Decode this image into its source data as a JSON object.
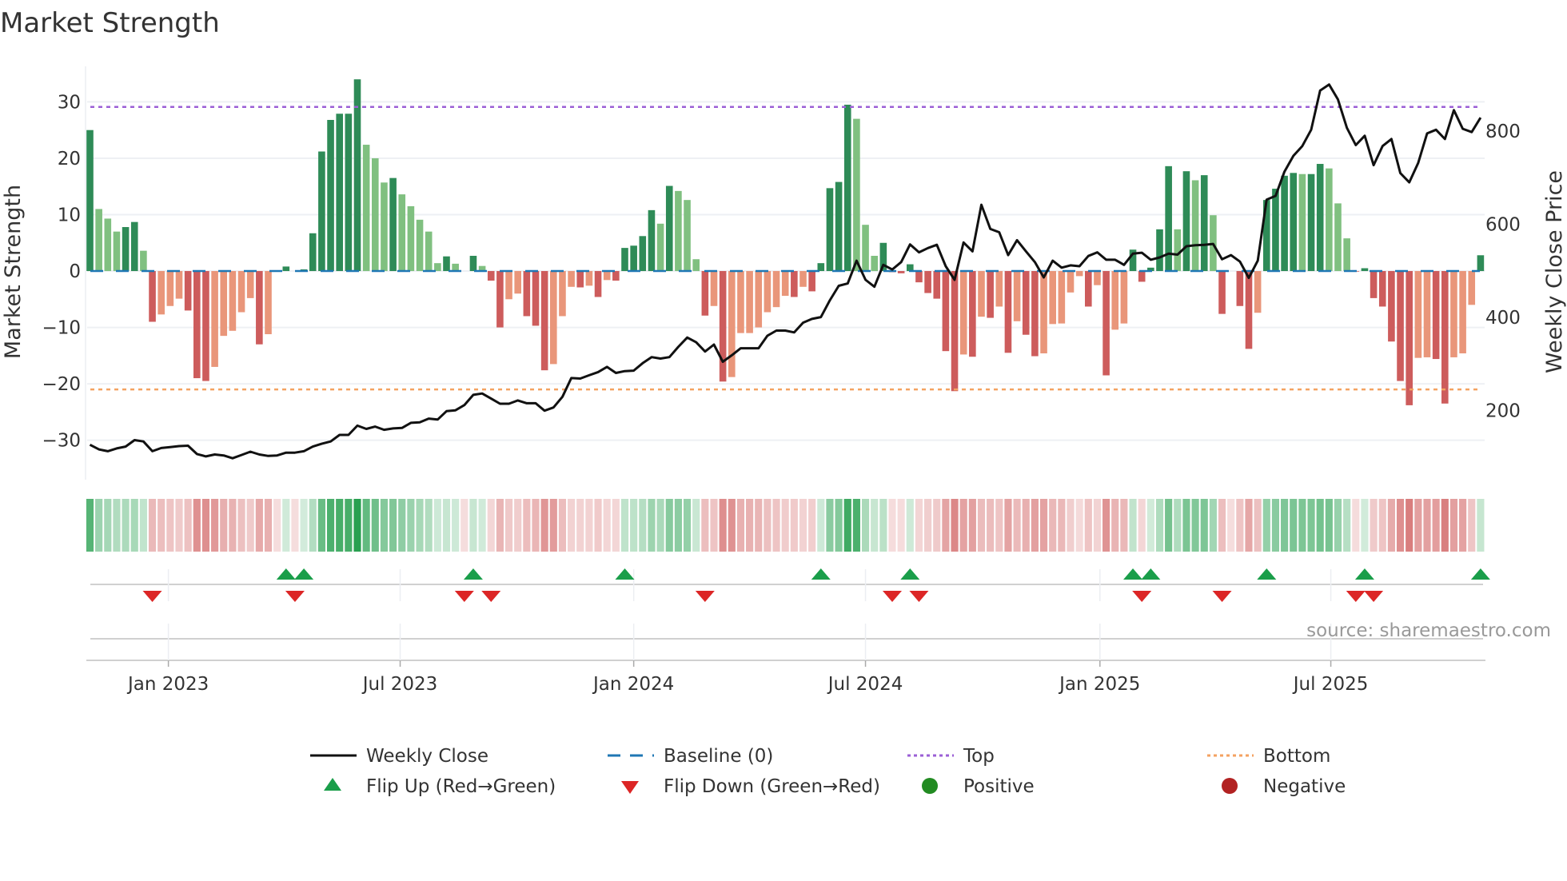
{
  "title": "Market Strength",
  "source": "source: sharemaestro.com",
  "colors": {
    "pos_rising": "#2e8b57",
    "pos_falling": "#80c080",
    "neg_falling": "#cd5c5c",
    "neg_rising": "#e9967a",
    "weekly_close": "#111111",
    "baseline": "#1f77b4",
    "top": "#9b5fd6",
    "bottom": "#f4a261",
    "flip_up": "#1a9e4a",
    "flip_down": "#dc2626",
    "positive": "#228b22",
    "negative": "#b22222"
  },
  "chart_data": {
    "type": "bar",
    "title": "Market Strength",
    "ylabel": "Market Strength",
    "y2label": "Weekly Close Price",
    "ylim": [
      -37,
      36.3
    ],
    "y2lim": [
      52,
      939
    ],
    "yticks": [
      -30,
      -20,
      -10,
      0,
      10,
      20,
      30
    ],
    "yticklabels": [
      "−30",
      "−20",
      "−10",
      "0",
      "10",
      "20",
      "30"
    ],
    "y2ticks": [
      200,
      400,
      600,
      800
    ],
    "y2ticklabels": [
      "200",
      "400",
      "600",
      "800"
    ],
    "xticks": [
      {
        "label": "Jan 2023",
        "week": 9.8
      },
      {
        "label": "Jul 2023",
        "week": 35.8
      },
      {
        "label": "Jan 2024",
        "week": 62.0
      },
      {
        "label": "Jul 2024",
        "week": 88.0
      },
      {
        "label": "Jan 2025",
        "week": 114.3
      },
      {
        "label": "Jul 2025",
        "week": 140.2
      }
    ],
    "top_level": 29.1,
    "bottom_level": -21.0,
    "baseline": 0,
    "strength": [
      25,
      11,
      9.3,
      7,
      7.8,
      8.7,
      3.6,
      -9,
      -7.7,
      -6.2,
      -4.9,
      -7,
      -19,
      -19.5,
      -17,
      -11.5,
      -10.6,
      -7.3,
      -4.8,
      -13,
      -11.2,
      0,
      0.8,
      0,
      0.3,
      6.7,
      21.2,
      26.8,
      27.9,
      27.9,
      34,
      22.4,
      20,
      15.7,
      16.5,
      13.6,
      11.5,
      9.1,
      7,
      1.4,
      2.6,
      1.3,
      0,
      2.7,
      0.9,
      -1.7,
      -10,
      -5,
      -4,
      -8,
      -9.7,
      -17.6,
      -16.5,
      -8,
      -2.8,
      -2.9,
      -2.6,
      -4.6,
      -1.6,
      -1.7,
      4.1,
      4.5,
      6.2,
      10.8,
      8.4,
      15.1,
      14.2,
      12.6,
      2.1,
      -7.9,
      -6.2,
      -19.6,
      -18.8,
      -11,
      -11,
      -10,
      -7.3,
      -6.4,
      -4.4,
      -4.6,
      -2.8,
      -3.6,
      1.4,
      14.7,
      15.8,
      29.5,
      27,
      8.2,
      2.7,
      5,
      -0.2,
      -0.4,
      1.2,
      -2,
      -3.9,
      -4.9,
      -14.2,
      -21.3,
      -14.8,
      -15.2,
      -8.1,
      -8.3,
      -6.3,
      -14.5,
      -8.9,
      -11.3,
      -15.1,
      -14.6,
      -9.4,
      -9.3,
      -3.8,
      -0.9,
      -6.3,
      -2.5,
      -18.5,
      -10.4,
      -9.3,
      3.8,
      -1.9,
      0.6,
      7.4,
      18.6,
      7.4,
      17.7,
      16.1,
      17,
      9.9,
      -7.6,
      0,
      -6.2,
      -13.8,
      -7.4,
      12.6,
      14.6,
      16.9,
      17.4,
      17.2,
      17.2,
      19,
      18.2,
      12,
      5.8,
      -0.1,
      0.5,
      -4.8,
      -6.3,
      -12.5,
      -19.5,
      -23.8,
      -15.4,
      -15.3,
      -15.6,
      -23.5,
      -15.3,
      -14.6,
      -6,
      2.8
    ],
    "weekly_close": [
      127,
      117,
      113,
      119,
      123,
      137,
      134,
      113,
      120,
      122,
      124,
      125,
      107,
      102,
      106,
      104,
      98,
      105,
      112,
      106,
      103,
      104,
      110,
      110,
      113,
      123,
      129,
      134,
      148,
      148,
      168,
      161,
      166,
      159,
      162,
      163,
      174,
      175,
      183,
      181,
      199,
      201,
      212,
      234,
      237,
      226,
      215,
      215,
      222,
      216,
      216,
      200,
      207,
      230,
      270,
      269,
      276,
      283,
      294,
      281,
      285,
      286,
      302,
      315,
      312,
      315,
      337,
      357,
      347,
      327,
      342,
      305,
      319,
      334,
      334,
      334,
      361,
      372,
      372,
      368,
      389,
      397,
      401,
      437,
      468,
      473,
      522,
      481,
      466,
      513,
      503,
      519,
      557,
      540,
      549,
      556,
      510,
      481,
      561,
      542,
      642,
      590,
      583,
      534,
      566,
      542,
      519,
      486,
      522,
      507,
      512,
      510,
      532,
      540,
      524,
      524,
      513,
      537,
      539,
      524,
      529,
      537,
      535,
      553,
      555,
      556,
      558,
      525,
      534,
      520,
      485,
      522,
      653,
      661,
      713,
      747,
      768,
      803,
      887,
      900,
      868,
      807,
      770,
      790,
      727,
      768,
      783,
      710,
      690,
      732,
      795,
      803,
      783,
      845,
      805,
      798,
      829
    ],
    "flip_up_weeks": [
      23,
      25,
      44,
      61,
      83,
      93,
      118,
      120,
      133,
      144,
      157
    ],
    "flip_down_weeks": [
      8,
      24,
      43,
      46,
      70,
      91,
      94,
      119,
      128,
      143,
      145
    ],
    "legend": {
      "placement": "bottom",
      "items": [
        {
          "label": "Weekly Close",
          "symbol": "line"
        },
        {
          "label": "Baseline (0)",
          "symbol": "dash"
        },
        {
          "label": "Top",
          "symbol": "dot-purple"
        },
        {
          "label": "Bottom",
          "symbol": "dot-orange"
        },
        {
          "label": "Flip Up (Red→Green)",
          "symbol": "triangle-up"
        },
        {
          "label": "Flip Down (Green→Red)",
          "symbol": "triangle-down"
        },
        {
          "label": "Positive",
          "symbol": "circle-green"
        },
        {
          "label": "Negative",
          "symbol": "circle-red"
        }
      ]
    }
  }
}
